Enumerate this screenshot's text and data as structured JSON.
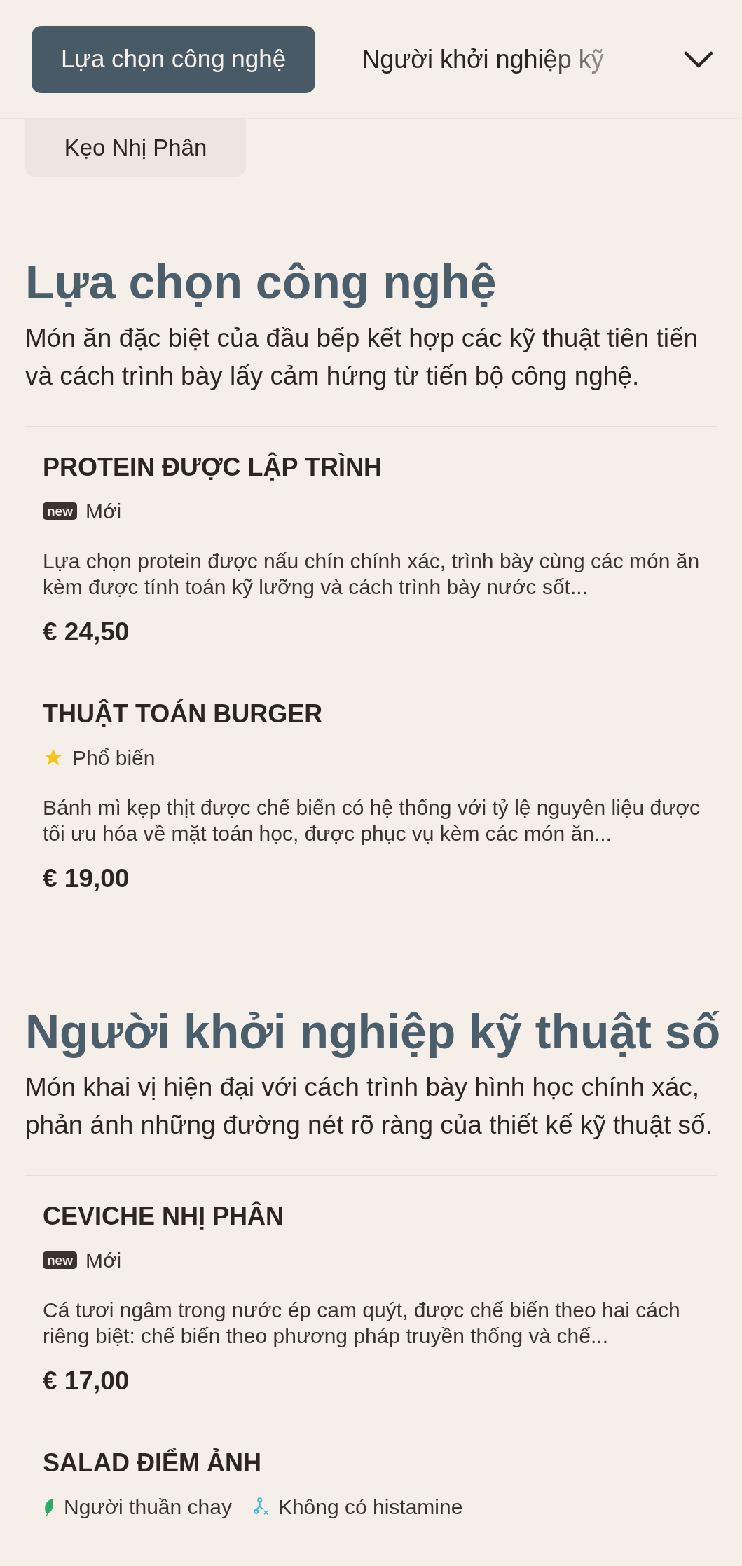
{
  "nav": {
    "tabs": [
      {
        "label": "Lựa chọn công nghệ",
        "selected": true
      },
      {
        "label": "Người khởi nghiệp kỹ",
        "selected": false
      }
    ],
    "chip": "Kẹo Nhị Phân"
  },
  "sections": [
    {
      "title": "Lựa chọn công nghệ",
      "description": "Món ăn đặc biệt của đầu bếp kết hợp các kỹ thuật tiên tiến và cách trình bày lấy cảm hứng từ tiến bộ công nghệ.",
      "items": [
        {
          "name": "PROTEIN ĐƯỢC LẬP TRÌNH",
          "tags": [
            {
              "kind": "new",
              "badge": "new",
              "label": "Mới"
            }
          ],
          "description": "Lựa chọn protein được nấu chín chính xác, trình bày cùng các món ăn kèm được tính toán kỹ lưỡng và cách trình bày nước sốt...",
          "price": "€ 24,50"
        },
        {
          "name": "THUẬT TOÁN BURGER",
          "tags": [
            {
              "kind": "popular",
              "label": "Phổ biến"
            }
          ],
          "description": "Bánh mì kẹp thịt được chế biến có hệ thống với tỷ lệ nguyên liệu được tối ưu hóa về mặt toán học, được phục vụ kèm các món ăn...",
          "price": "€ 19,00"
        }
      ]
    },
    {
      "title": "Người khởi nghiệp kỹ thuật số",
      "description": "Món khai vị hiện đại với cách trình bày hình học chính xác, phản ánh những đường nét rõ ràng của thiết kế kỹ thuật số.",
      "items": [
        {
          "name": "CEVICHE NHỊ PHÂN",
          "tags": [
            {
              "kind": "new",
              "badge": "new",
              "label": "Mới"
            }
          ],
          "description": "Cá tươi ngâm trong nước ép cam quýt, được chế biến theo hai cách riêng biệt: chế biến theo phương pháp truyền thống và chế...",
          "price": "€ 17,00"
        },
        {
          "name": "SALAD ĐIỂM ẢNH",
          "tags": [
            {
              "kind": "vegan",
              "label": "Người thuần chay"
            },
            {
              "kind": "histamine-free",
              "label": "Không có histamine"
            }
          ]
        }
      ]
    }
  ]
}
